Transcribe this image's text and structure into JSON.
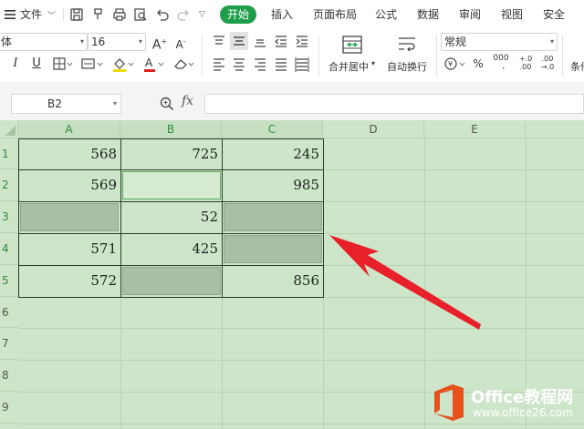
{
  "menu": {
    "file": "文件",
    "tabs": [
      "开始",
      "插入",
      "页面布局",
      "公式",
      "数据",
      "审阅",
      "视图",
      "安全"
    ]
  },
  "toolbar": {
    "font_name": "体",
    "font_size": "16",
    "number_format": "常规",
    "merge_center": "合并居中",
    "wrap_text": "自动换行",
    "cond_format": "条件"
  },
  "formula_bar": {
    "name_box": "B2",
    "fx": "fx"
  },
  "sheet": {
    "columns": [
      "A",
      "B",
      "C",
      "D",
      "E"
    ],
    "rows": [
      "1",
      "2",
      "3",
      "4",
      "5",
      "6",
      "7",
      "8",
      "9"
    ],
    "cells": {
      "A1": "568",
      "B1": "725",
      "C1": "245",
      "A2": "569",
      "C2": "985",
      "B3": "52",
      "A4": "571",
      "B4": "425",
      "A5": "572",
      "C5": "856"
    }
  },
  "colors": {
    "accent": "#1e9e4a",
    "sheet_bg": "#cde6c9",
    "blank_fill": "#a9bfa5",
    "arrow": "#e8202a",
    "logo_orange": "#e8511e"
  },
  "watermark": {
    "brand": "Office教程网",
    "url": "www.office26.com"
  }
}
